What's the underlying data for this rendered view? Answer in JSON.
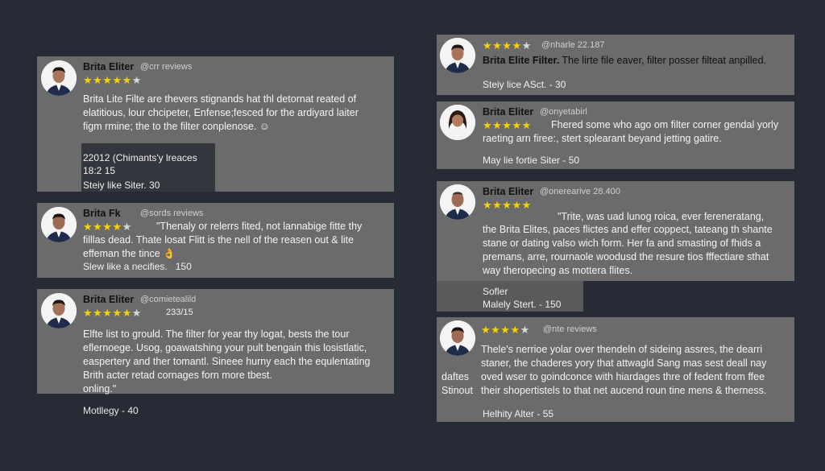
{
  "colors": {
    "background": "#262b35",
    "card": "#6b6b6b",
    "star": "#f5d20a",
    "meta_box": "#34363d"
  },
  "left": {
    "card1": {
      "name": "Brita Eliter",
      "handle": "@crr reviews",
      "rating": 5.5,
      "body_lines": [
        "Brita Lite Filte are thevers stignands hat thl detornat reated of",
        "elatitious, lour chcipeter, Enfense;fesced for the ardiyard laiter",
        "figm rmine; the to the filter conplenose. ☺"
      ],
      "meta_lines": [
        "22012 (Chimants'y lreaces",
        "18:2 15",
        "Steiy like Siter.  30"
      ]
    },
    "card2": {
      "name": "Brita Fk",
      "handle": "@sords reviews",
      "rating": 4.5,
      "quote_line": "\"Thenaly or relerrs fited, not lannabige fitte  thy",
      "body_lines": [
        "filllas dead. Thate losat Flitt is the nell of the reasen out & lite",
        "effeman the tince 👌"
      ],
      "meta": "Slew like a necifies.   150"
    },
    "card3": {
      "name": "Brita Eliter",
      "handle": "@comietealild",
      "rating": 5.5,
      "count": "233/15",
      "body_lines": [
        "Elfte list to grould. The filter for year thy logat, bests the tour",
        "eflernoege. Usog, goawatshing your pult bengain this losistlatic,",
        "easpertery and ther tomantl. Sineee hurny each the equlentating",
        "Brith acter retad cornages forn more tbest.",
        "onling.\""
      ]
    },
    "floating_meta": "Motllegy - 40"
  },
  "right": {
    "card1": {
      "name": "Brita Elite Filter.",
      "handle": "@nharle 22.187",
      "rating": 4.5,
      "headline_rest": "The lirte file eaver, filter posser filteat anpilled.",
      "meta": "Steiy lice ASct. - 30"
    },
    "card2": {
      "name": "Brita Eliter",
      "handle": "@onyetabirl",
      "rating": 5,
      "body_first": "Fhered some who ago om filter corner gendal yorly",
      "body_lines": [
        "raeting arn firee:, stert splearant beyand jetting gatire."
      ],
      "meta": "May lie fortie Siter - 50"
    },
    "card3": {
      "name": "Brita Eliter",
      "handle": "@onerearive 28.400",
      "rating": 5,
      "quote_line": "\"Trite, was uad lunog roica, ever fereneratang,",
      "body_lines": [
        "the Brita Elites, paces flictes and effer coppect, tateang th shante",
        "stane or dating valso wich form. Her fa and smasting of fhids a",
        "premans, arre, rournaole woodusd the resure tios fffectiare sthat",
        "way theropecing as mottera flites."
      ],
      "meta_lines": [
        "Sofler",
        "Malely Stert. - 150"
      ]
    },
    "card4": {
      "handle": "@nte reviews",
      "rating": 3.5,
      "body_lines": [
        "Thele's nerrioe yolar over thendeln of sideing assres, the dearri",
        "staner, the chaderes yory that attwagld Sang mas sest deall nay",
        "oved wser to goindconce with hiardages thre of fedent from ffee",
        "their shopertistels to that net aucend roun tine mens & therness."
      ],
      "side_labels": [
        "daftes",
        "Stinout"
      ],
      "meta": "Helhity Alter - 55"
    }
  }
}
